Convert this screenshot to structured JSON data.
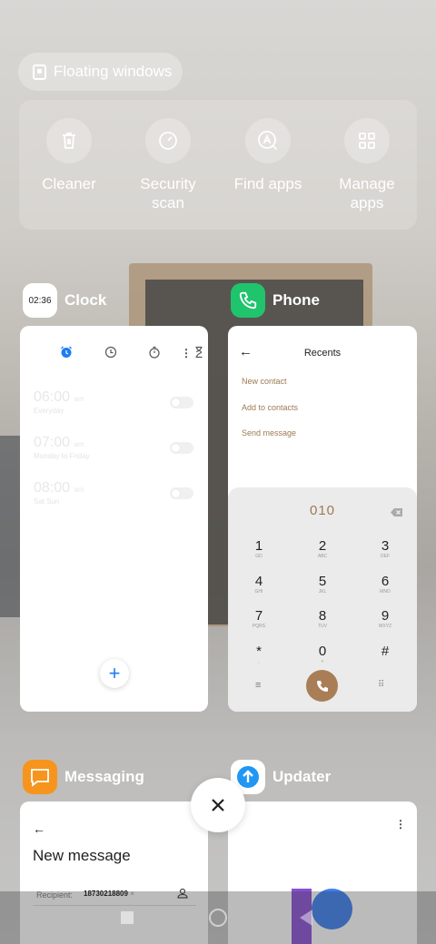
{
  "floating": {
    "label": "Floating windows"
  },
  "tools": [
    {
      "label": "Cleaner",
      "icon": "trash-icon"
    },
    {
      "label": "Security scan",
      "icon": "gauge-icon"
    },
    {
      "label": "Find apps",
      "icon": "app-search-icon"
    },
    {
      "label": "Manage apps",
      "icon": "grid-icon"
    }
  ],
  "clock": {
    "name": "Clock",
    "icon_text": "02:36",
    "alarms": [
      {
        "time": "06:00",
        "ampm": "am",
        "repeat": "Everyday"
      },
      {
        "time": "07:00",
        "ampm": "am",
        "repeat": "Monday to Friday"
      },
      {
        "time": "08:00",
        "ampm": "am",
        "repeat": "Sat Sun"
      }
    ]
  },
  "phone": {
    "name": "Phone",
    "title": "Recents",
    "actions": [
      "New contact",
      "Add to contacts",
      "Send message"
    ],
    "dial_number": "010",
    "keys": [
      {
        "d": "1",
        "l": "GD"
      },
      {
        "d": "2",
        "l": "ABC"
      },
      {
        "d": "3",
        "l": "DEF"
      },
      {
        "d": "4",
        "l": "GHI"
      },
      {
        "d": "5",
        "l": "JKL"
      },
      {
        "d": "6",
        "l": "MNO"
      },
      {
        "d": "7",
        "l": "PQRS"
      },
      {
        "d": "8",
        "l": "TUV"
      },
      {
        "d": "9",
        "l": "WXYZ"
      },
      {
        "d": "*",
        "l": ","
      },
      {
        "d": "0",
        "l": "+"
      },
      {
        "d": "#",
        "l": ""
      }
    ]
  },
  "messaging": {
    "name": "Messaging",
    "title": "New message",
    "recipient_label": "Recipient:",
    "recipient_value": "18730218809"
  },
  "updater": {
    "name": "Updater"
  },
  "colors": {
    "phone_accent": "#9d7a53",
    "clock_accent": "#1e7cf5",
    "phone_icon": "#1fc46c",
    "messaging_icon": "#f7941d",
    "updater_icon": "#2196f3"
  }
}
